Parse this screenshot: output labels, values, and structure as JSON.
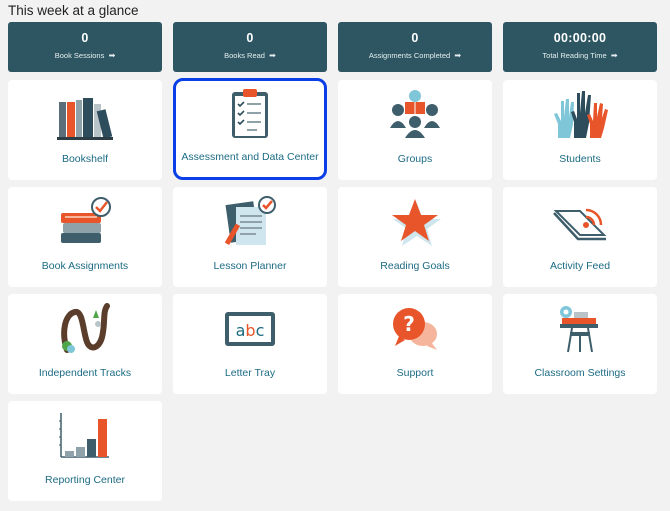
{
  "heading": "This week at a glance",
  "stats": [
    {
      "value": "0",
      "label": "Book Sessions"
    },
    {
      "value": "0",
      "label": "Books Read"
    },
    {
      "value": "0",
      "label": "Assignments Completed"
    },
    {
      "value": "00:00:00",
      "label": "Total Reading Time"
    }
  ],
  "tiles": [
    {
      "label": "Bookshelf",
      "icon": "bookshelf-icon"
    },
    {
      "label": "Assessment and Data Center",
      "icon": "clipboard-checklist-icon",
      "selected": true
    },
    {
      "label": "Groups",
      "icon": "group-reading-icon"
    },
    {
      "label": "Students",
      "icon": "raised-hands-icon"
    },
    {
      "label": "Book Assignments",
      "icon": "book-stack-check-icon"
    },
    {
      "label": "Lesson Planner",
      "icon": "planner-pen-icon"
    },
    {
      "label": "Reading Goals",
      "icon": "star-icon"
    },
    {
      "label": "Activity Feed",
      "icon": "open-book-feed-icon"
    },
    {
      "label": "Independent Tracks",
      "icon": "winding-track-icon"
    },
    {
      "label": "Letter Tray",
      "icon": "abc-tray-icon"
    },
    {
      "label": "Support",
      "icon": "question-bubble-icon"
    },
    {
      "label": "Classroom Settings",
      "icon": "desk-gear-icon"
    },
    {
      "label": "Reporting Center",
      "icon": "bar-chart-icon"
    }
  ],
  "colors": {
    "stat_bg": "#2d5662",
    "tile_label": "#1c6b84",
    "selected_border": "#0a3ee6",
    "accent_orange": "#e8552a",
    "page_bg": "#f2f2f2"
  }
}
